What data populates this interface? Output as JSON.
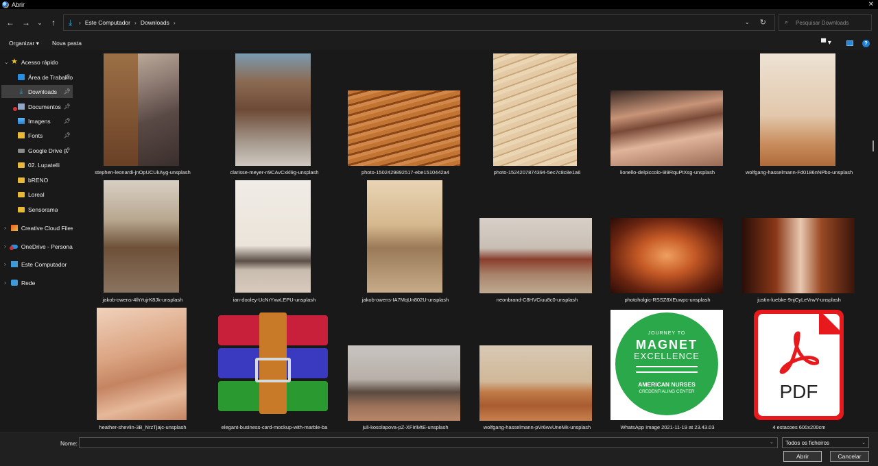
{
  "window": {
    "title": "Abrir"
  },
  "address": {
    "crumbs": [
      "Este Computador",
      "Downloads"
    ]
  },
  "search": {
    "placeholder": "Pesquisar Downloads"
  },
  "toolbar": {
    "organize": "Organizar ▾",
    "new_folder": "Nova pasta"
  },
  "sidebar": {
    "items": [
      {
        "label": "Acesso rápido",
        "icon": "star-icon"
      },
      {
        "label": "Área de Trabalho",
        "icon": "desktop-icon",
        "pinned": true
      },
      {
        "label": "Downloads",
        "icon": "download-icon",
        "pinned": true,
        "selected": true
      },
      {
        "label": "Documentos",
        "icon": "documents-icon",
        "pinned": true,
        "error": true
      },
      {
        "label": "Imagens",
        "icon": "images-icon",
        "pinned": true
      },
      {
        "label": "Fonts",
        "icon": "fonts-folder-icon",
        "pinned": true
      },
      {
        "label": "Google Drive (G:)",
        "icon": "drive-icon",
        "pinned": true
      },
      {
        "label": "02. Lupatelli",
        "icon": "folder-icon"
      },
      {
        "label": "bRENO",
        "icon": "folder-icon"
      },
      {
        "label": "Loreal",
        "icon": "folder-icon"
      },
      {
        "label": "Sensorama",
        "icon": "folder-icon"
      },
      {
        "label": "Creative Cloud Files",
        "icon": "creative-cloud-icon"
      },
      {
        "label": "OneDrive - Personal",
        "icon": "onedrive-icon",
        "error": true
      },
      {
        "label": "Este Computador",
        "icon": "computer-icon"
      },
      {
        "label": "Rede",
        "icon": "network-icon"
      }
    ]
  },
  "files": [
    {
      "name": "stephen-leonardi-jnOpUCUkAyg-unsplash"
    },
    {
      "name": "clarisse-meyer-n9CAvCxkl9g-unsplash"
    },
    {
      "name": "photo-1502429892517-ebe1510442a4"
    },
    {
      "name": "photo-1524207874394-5ec7c8c8e1a6"
    },
    {
      "name": "lionello-delpiccolo-9i9RquPtXsg-unsplash"
    },
    {
      "name": "wolfgang-hasselmann-Fd0186nNPbo-unsplash"
    },
    {
      "name": "jakob-owens-4lhYujrK8Jk-unsplash"
    },
    {
      "name": "ian-dooley-UcNrYxwLEPU-unsplash"
    },
    {
      "name": "jakob-owens-IA7MqUn802U-unsplash"
    },
    {
      "name": "neonbrand-C8HVCiuu8c0-unsplash"
    },
    {
      "name": "photoholgic-RSSZ8XEuwpc-unsplash"
    },
    {
      "name": "justin-luebke-9njCyLeVrwY-unsplash"
    },
    {
      "name": "heather-shevlin-3B_NrzTjajc-unsplash"
    },
    {
      "name": "elegant-business-card-mockup-with-marble-ba"
    },
    {
      "name": "juli-kosolapova-pZ-XFIrlMtE-unsplash"
    },
    {
      "name": "wolfgang-hasselmann-pVr6wvUneMk-unsplash"
    },
    {
      "name": "WhatsApp Image 2021-11-19 at 23.43.03",
      "logo_text": [
        "JOURNEY TO",
        "MAGNET",
        "EXCELLENCE",
        "AMERICAN NURSES",
        "CREDENTIALING CENTER"
      ]
    },
    {
      "name": "4 estacoes 600x200cm",
      "pdf_label": "PDF"
    }
  ],
  "footer": {
    "name_label": "Nome:",
    "name_value": "",
    "filter": "Todos os ficheiros",
    "open": "Abrir",
    "cancel": "Cancelar"
  }
}
